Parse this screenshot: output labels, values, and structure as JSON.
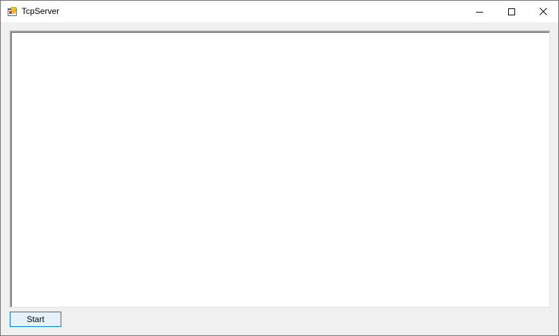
{
  "window": {
    "title": "TcpServer",
    "app_icon": "winforms-app-icon",
    "controls": {
      "minimize_icon": "minimize-icon",
      "maximize_icon": "maximize-icon",
      "close_icon": "close-icon"
    }
  },
  "log": {
    "text": ""
  },
  "toolbar": {
    "start_label": "Start"
  },
  "colors": {
    "button_background": "#e5f1fb",
    "button_border": "#0078d7",
    "window_background": "#f0f0f0",
    "titlebar_background": "#ffffff"
  }
}
